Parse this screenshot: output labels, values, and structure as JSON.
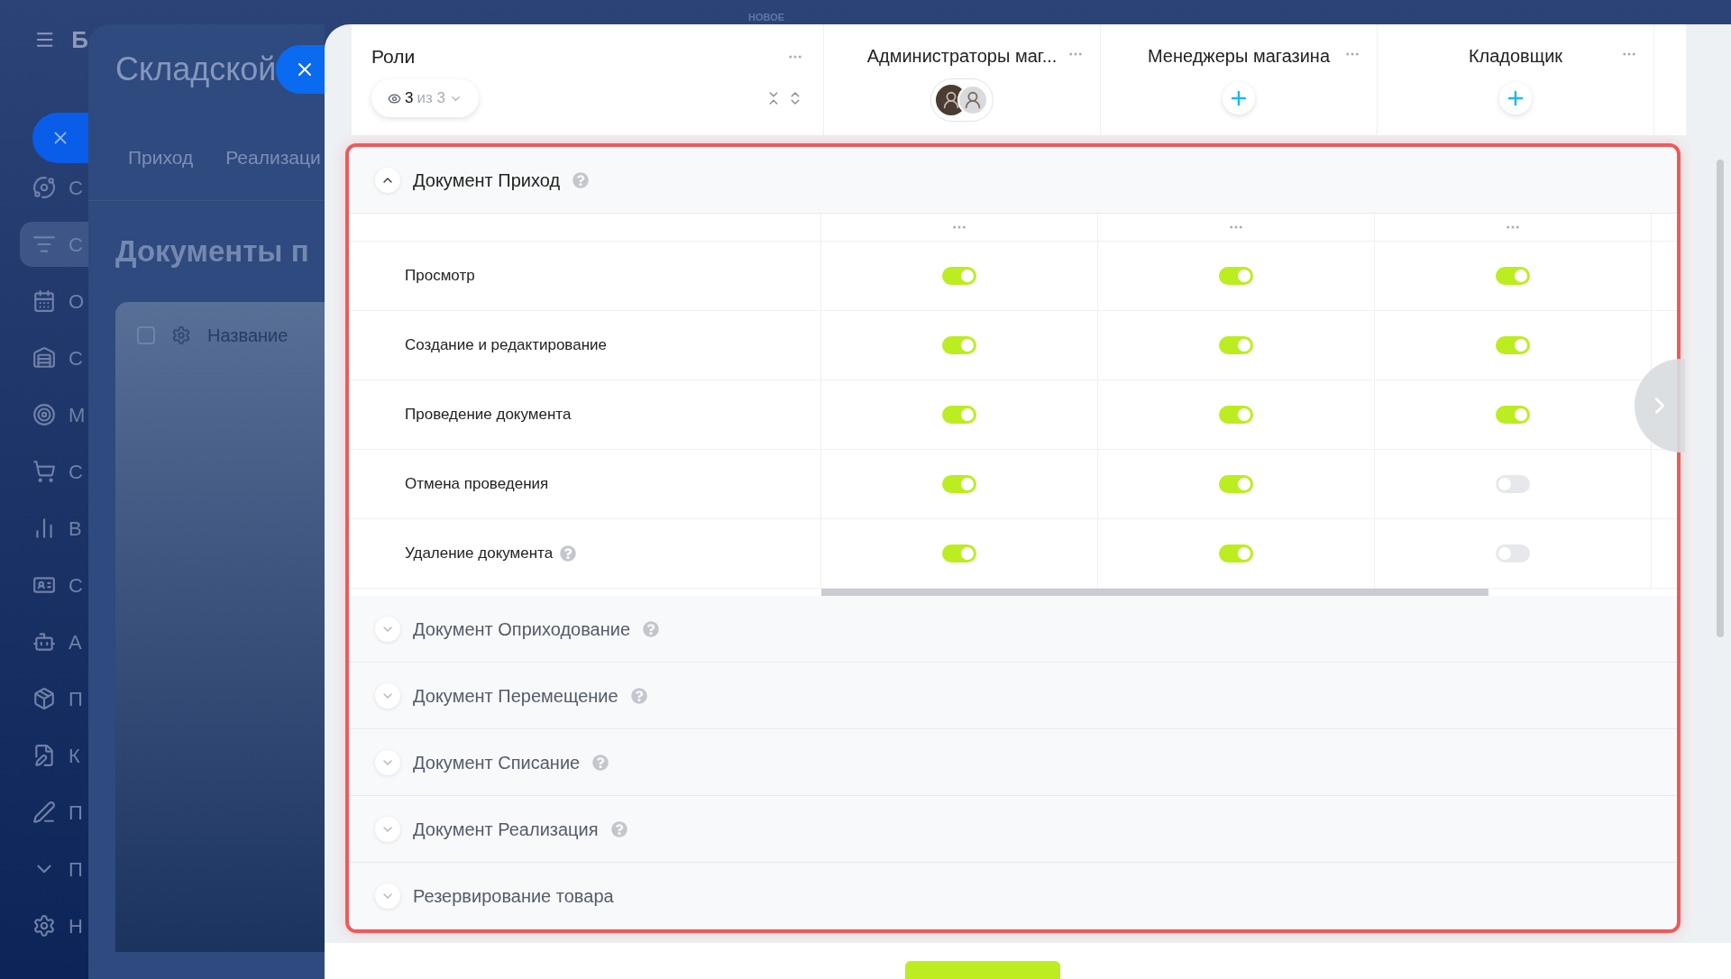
{
  "sidebar": {
    "logo": "Б",
    "items": [
      {
        "label": "С",
        "selected": false
      },
      {
        "label": "С",
        "selected": true
      },
      {
        "label": "О",
        "selected": false
      },
      {
        "label": "С",
        "selected": false
      },
      {
        "label": "М",
        "selected": false
      },
      {
        "label": "С",
        "selected": false
      },
      {
        "label": "В",
        "selected": false
      },
      {
        "label": "С",
        "selected": false
      },
      {
        "label": "А",
        "selected": false
      },
      {
        "label": "П",
        "selected": false
      },
      {
        "label": "К",
        "selected": false
      },
      {
        "label": "П",
        "selected": false
      },
      {
        "label": "П",
        "selected": false
      },
      {
        "label": "Н",
        "selected": false
      }
    ]
  },
  "back_panel": {
    "title": "Складской",
    "tabs": [
      "Приход",
      "Реализаци"
    ],
    "heading": "Документы п",
    "column": "Название",
    "checked": false
  },
  "top_badge": "НОВОЕ",
  "roles_header": {
    "title": "Роли",
    "filter": {
      "shown": "3",
      "total": "из 3"
    }
  },
  "roles": [
    {
      "name": "Администраторы маг...",
      "kind": "avatars"
    },
    {
      "name": "Менеджеры магазина",
      "kind": "add"
    },
    {
      "name": "Кладовщик",
      "kind": "add"
    }
  ],
  "sections": [
    {
      "title": "Документ Приход",
      "help": true,
      "expanded": true,
      "permissions": [
        {
          "name": "Просмотр",
          "help": false,
          "toggles": [
            {
              "on": true
            },
            {
              "on": true
            },
            {
              "on": true
            }
          ]
        },
        {
          "name": "Создание и редактирование",
          "help": false,
          "toggles": [
            {
              "on": true
            },
            {
              "on": true
            },
            {
              "on": true
            }
          ]
        },
        {
          "name": "Проведение документа",
          "help": false,
          "toggles": [
            {
              "on": true
            },
            {
              "on": true
            },
            {
              "on": true
            }
          ]
        },
        {
          "name": "Отмена проведения",
          "help": false,
          "toggles": [
            {
              "on": true
            },
            {
              "on": true
            },
            {
              "on": false
            }
          ]
        },
        {
          "name": "Удаление документа",
          "help": true,
          "toggles": [
            {
              "on": true
            },
            {
              "on": true
            },
            {
              "on": false
            }
          ]
        }
      ]
    },
    {
      "title": "Документ Оприходование",
      "help": true,
      "expanded": false
    },
    {
      "title": "Документ Перемещение",
      "help": true,
      "expanded": false
    },
    {
      "title": "Документ Списание",
      "help": true,
      "expanded": false
    },
    {
      "title": "Документ Реализация",
      "help": true,
      "expanded": false
    },
    {
      "title": "Резервирование товара",
      "help": false,
      "expanded": false
    }
  ]
}
